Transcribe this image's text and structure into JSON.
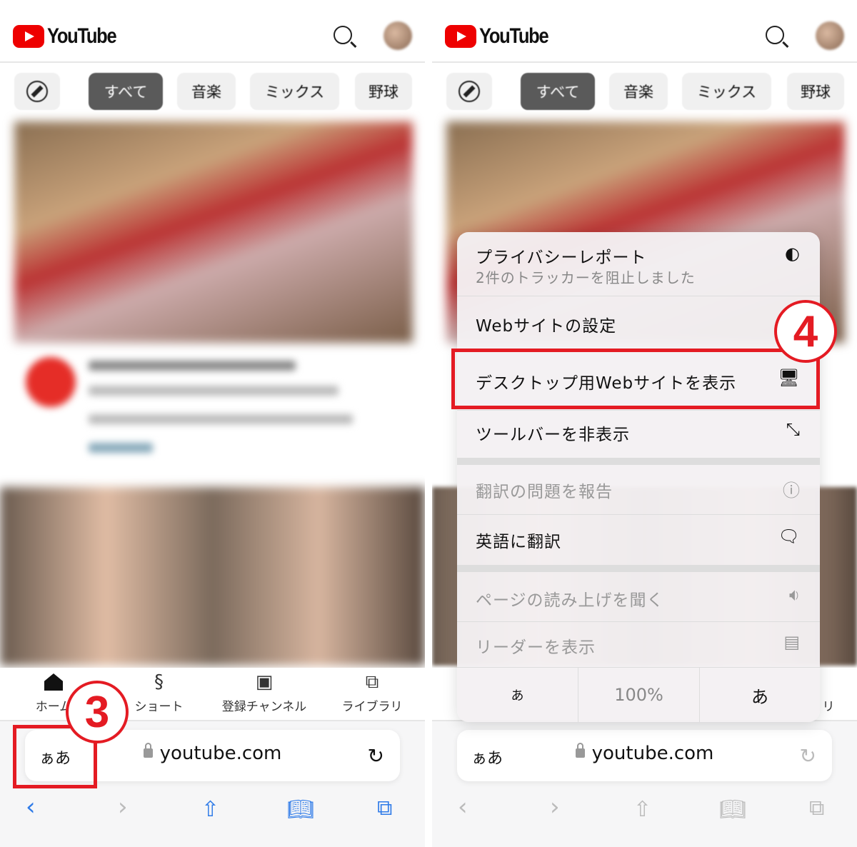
{
  "brand": {
    "logo_text": "YouTube",
    "accent": "#ff0000",
    "annotation_color": "#e41b23"
  },
  "chips": [
    "すべて",
    "音楽",
    "ミックス",
    "野球"
  ],
  "bottom_nav": [
    {
      "label": "ホーム",
      "icon": "home-icon"
    },
    {
      "label": "ショート",
      "icon": "shorts-icon"
    },
    {
      "label": "登録チャンネル",
      "icon": "subscriptions-icon"
    },
    {
      "label": "ライブラリ",
      "icon": "library-icon"
    }
  ],
  "address_bar": {
    "aa": "ぁあ",
    "url": "youtube.com"
  },
  "annotations": {
    "step3": "3",
    "step4": "4"
  },
  "menu": {
    "privacy_title": "プライバシーレポート",
    "privacy_sub": "2件のトラッカーを阻止しました",
    "site_settings": "Webサイトの設定",
    "desktop_site": "デスクトップ用Webサイトを表示",
    "hide_toolbar": "ツールバーを非表示",
    "report_translation": "翻訳の問題を報告",
    "translate_en": "英語に翻訳",
    "listen": "ページの読み上げを聞く",
    "reader": "リーダーを表示",
    "font_small": "あ",
    "zoom": "100%",
    "font_large": "あ"
  },
  "peek_label": "リ"
}
